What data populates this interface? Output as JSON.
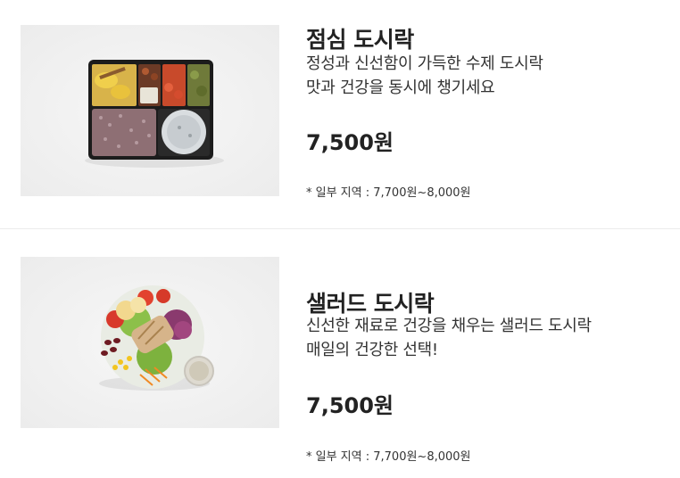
{
  "products": [
    {
      "title": "점심 도시락",
      "desc_lines": [
        "정성과 신선함이 가득한 수제 도시락",
        "맛과 건강을 동시에 챙기세요"
      ],
      "price": "7,500원",
      "note": "* 일부 지역 : 7,700원~8,000원",
      "image_icon": "lunchbox-photo"
    },
    {
      "title": "샐러드 도시락",
      "desc_lines": [
        "신선한 재료로 건강을 채우는 샐러드 도시락",
        "매일의 건강한 선택!"
      ],
      "price": "7,500원",
      "note": "* 일부 지역 : 7,700원~8,000원",
      "image_icon": "salad-photo"
    }
  ],
  "colors": {
    "text_primary": "#222222",
    "divider": "#ececec",
    "photo_bg": "#eeeeee"
  }
}
